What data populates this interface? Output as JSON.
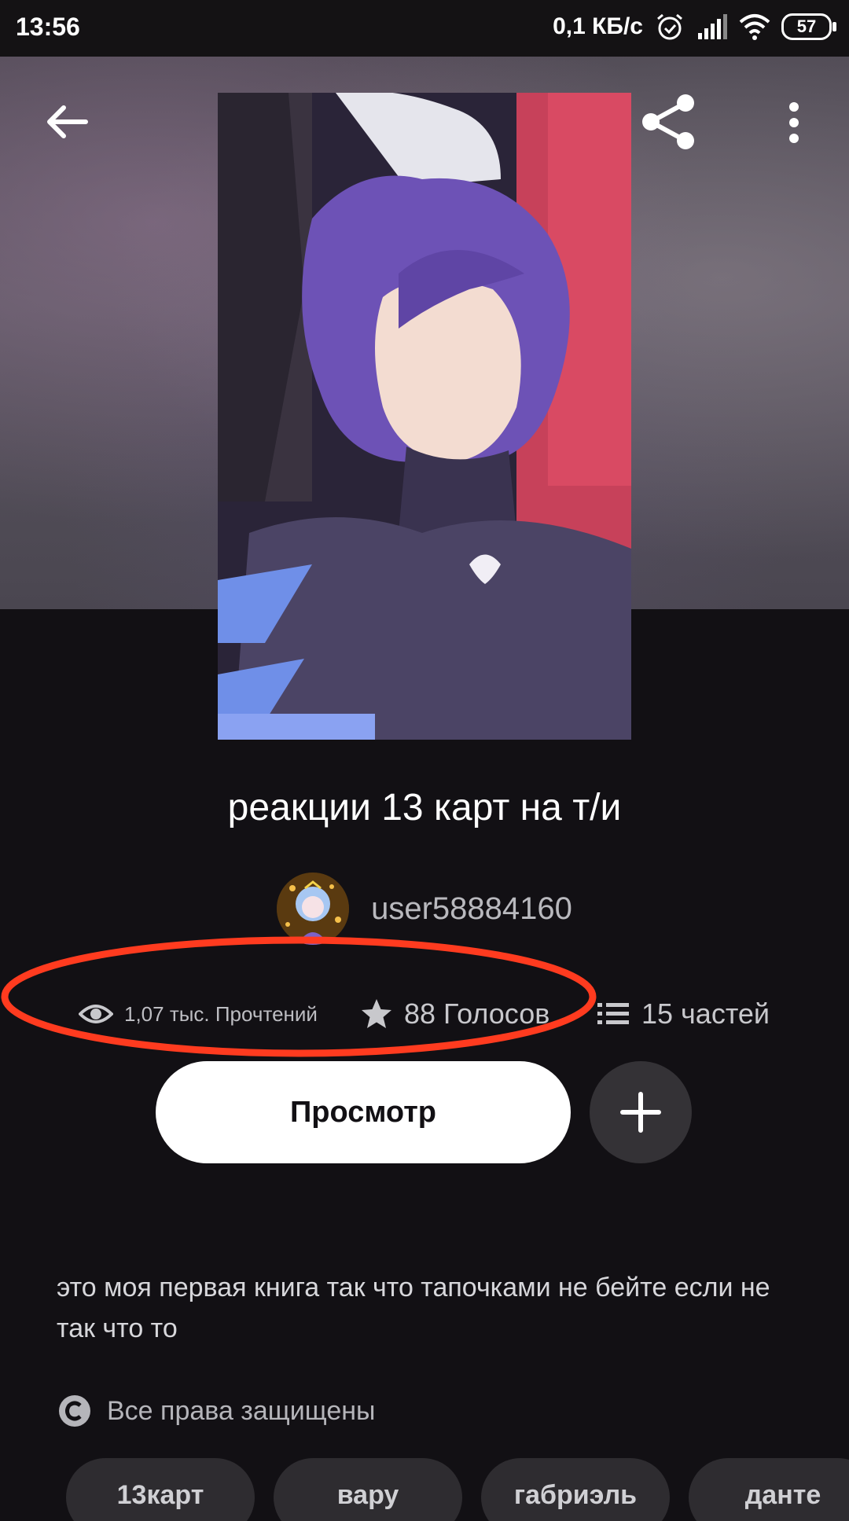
{
  "status_bar": {
    "time": "13:56",
    "speed": "0,1 КБ/с",
    "battery": "57",
    "icons": [
      "alarm-icon",
      "signal-icon",
      "wifi-icon",
      "battery-icon"
    ]
  },
  "toolbar": {
    "back_icon": "arrow-left-icon",
    "share_icon": "share-icon",
    "more_icon": "more-vertical-icon"
  },
  "story": {
    "title": "реакции 13 карт на т/и",
    "author": "user58884160",
    "stats": {
      "reads": "1,07 тыс. Прочтений",
      "votes": "88 Голосов",
      "parts": "15 частей"
    },
    "description": "это моя первая книга так что тапочками не бейте если не так что то",
    "copyright": "Все права защищены"
  },
  "actions": {
    "view_label": "Просмотр",
    "add_icon": "plus-icon"
  },
  "tags": [
    "13карт",
    "вару",
    "габриэль",
    "данте"
  ],
  "colors": {
    "background": "#121014",
    "annotation": "#ff3b1f",
    "primary_button": "#ffffff",
    "secondary_button": "#343236"
  }
}
